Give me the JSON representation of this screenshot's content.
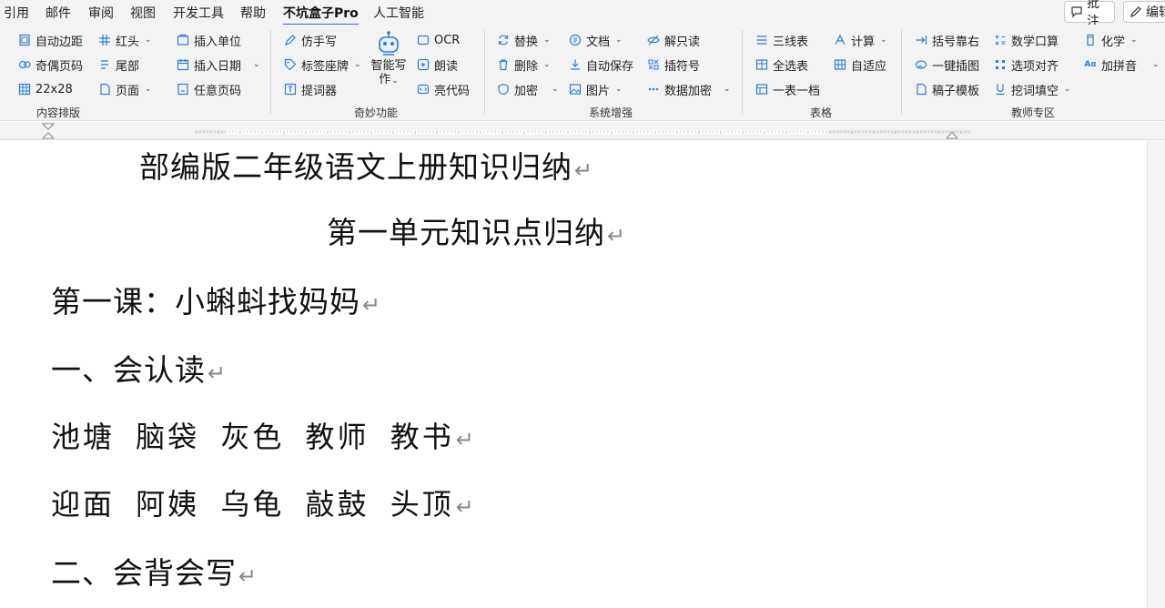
{
  "menu": {
    "items": [
      "引用",
      "邮件",
      "审阅",
      "视图",
      "开发工具",
      "帮助",
      "不坑盒子Pro",
      "人工智能"
    ],
    "active": "不坑盒子Pro",
    "comment_label": "批注",
    "edit_label": "编辑"
  },
  "ribbon": {
    "layout_group": {
      "label": "内容排版",
      "auto_margin": "自动边距",
      "odd_even_page": "奇偶页码",
      "grid_22x28": "22x28",
      "red_header": "红头",
      "tail": "尾部",
      "page": "页面"
    },
    "insert_group": {
      "insert_unit": "插入单位",
      "insert_date": "插入日期",
      "any_page_number": "任意页码"
    },
    "magic_group": {
      "label": "奇妙功能",
      "handwriting": "仿手写",
      "label_seat": "标签座牌",
      "teleprompter": "提词器",
      "smart_writing_1": "智能写",
      "smart_writing_2": "作",
      "ocr": "OCR",
      "read_aloud": "朗读",
      "highlight_code": "亮代码"
    },
    "system_group": {
      "label": "系统增强",
      "replace": "替换",
      "delete": "删除",
      "encrypt": "加密",
      "document": "文档",
      "auto_save": "自动保存",
      "image": "图片",
      "unlock_readonly": "解只读",
      "insert_symbol": "插符号",
      "data_encrypt": "数据加密"
    },
    "table_group": {
      "label": "表格",
      "three_line_table": "三线表",
      "select_all_tables": "全选表",
      "one_table_one_file": "一表一档",
      "calculate": "计算",
      "auto_fit": "自适应"
    },
    "teacher_group": {
      "label": "教师专区",
      "bracket_right": "括号靠右",
      "one_click_image": "一键插图",
      "draft_template": "稿子模板",
      "math_oral": "数学口算",
      "align_options": "选项对齐",
      "fill_blank": "挖词填空",
      "chemistry": "化学",
      "add_pinyin": "加拼音"
    }
  },
  "document": {
    "title": "部编版二年级语文上册知识归纳",
    "unit_title": "第一单元知识点归纳",
    "lesson_title": "第一课：小蝌蚪找妈妈",
    "section1": "一、会认读",
    "words_line1": "池塘 脑袋 灰色 教师 教书",
    "words_line2": "迎面 阿姨 乌龟 敲鼓 头顶",
    "section2": "二、会背会写",
    "paragraph_mark": "↵"
  },
  "colors": {
    "accent": "#2b6de0",
    "icon_blue": "#2f7bd6",
    "ribbon_bg": "#f3f3f3",
    "paragraph_mark": "#888888"
  }
}
